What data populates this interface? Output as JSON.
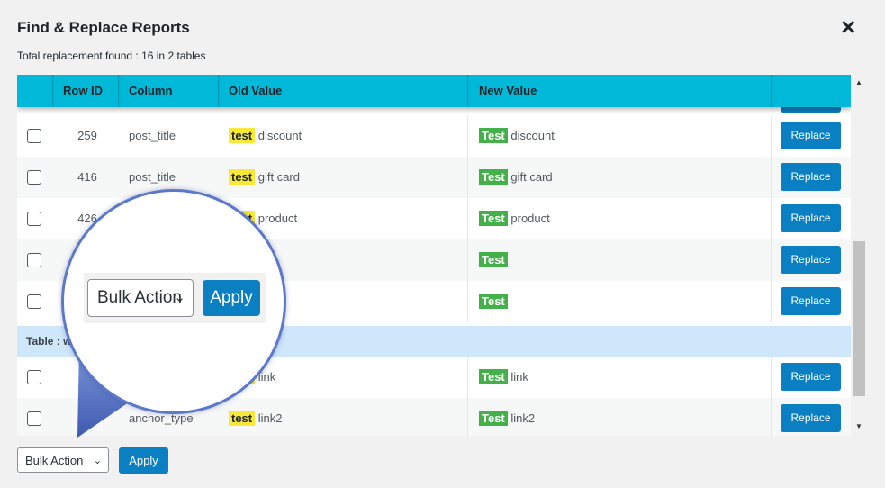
{
  "modal": {
    "title": "Find & Replace Reports",
    "close_symbol": "✕",
    "summary": "Total replacement found : 16 in 2 tables"
  },
  "table": {
    "headers": [
      "Row ID",
      "Column",
      "Old Value",
      "New Value"
    ],
    "rows": [
      {
        "row_id": "259",
        "column": "post_title",
        "old_hl": "test",
        "old_rest": "discount",
        "new_hl": "Test",
        "new_rest": "discount",
        "action": "Replace"
      },
      {
        "row_id": "416",
        "column": "post_title",
        "old_hl": "test",
        "old_rest": "gift card",
        "new_hl": "Test",
        "new_rest": "gift card",
        "action": "Replace"
      },
      {
        "row_id": "426",
        "column": "",
        "old_hl": "test",
        "old_rest": "product",
        "new_hl": "Test",
        "new_rest": "product",
        "action": "Replace"
      },
      {
        "row_id": "",
        "column": "",
        "old_hl": "",
        "old_rest": "",
        "new_hl": "Test",
        "new_rest": "",
        "action": "Replace"
      },
      {
        "row_id": "",
        "column": "",
        "old_hl": "",
        "old_rest": "",
        "new_hl": "Test",
        "new_rest": "",
        "action": "Replace"
      }
    ],
    "group_label": "Table : w",
    "rows2": [
      {
        "row_id": "",
        "column": "",
        "old_hl": "test",
        "old_rest": "link",
        "new_hl": "Test",
        "new_rest": "link",
        "action": "Replace"
      },
      {
        "row_id": "",
        "column": "anchor_type",
        "old_hl": "test",
        "old_rest": "link2",
        "new_hl": "Test",
        "new_rest": "link2",
        "action": "Replace"
      }
    ]
  },
  "bulk": {
    "select_label": "Bulk Action",
    "apply_label": "Apply"
  },
  "magnifier": {
    "select_label": "Bulk Action",
    "apply_label": "Apply"
  },
  "colors": {
    "header_bg": "#00b9d9",
    "button_blue": "#0a7fc2",
    "old_highlight": "#f7e839",
    "new_highlight": "#43b04a",
    "group_bg": "#cfe7fb",
    "magnifier_ring": "#5b78c9"
  },
  "icons": {
    "close": "close-icon",
    "chevron": "chevron-down-icon",
    "scroll_up": "scroll-up-arrow-icon",
    "scroll_down": "scroll-down-arrow-icon"
  }
}
